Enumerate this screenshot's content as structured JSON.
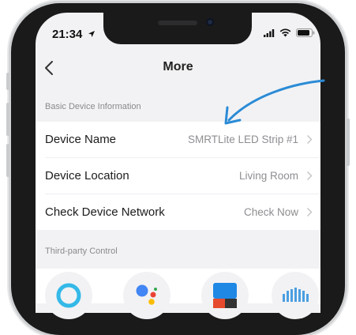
{
  "status": {
    "time": "21:34"
  },
  "nav": {
    "title": "More"
  },
  "sections": [
    {
      "header": "Basic Device Information",
      "rows": [
        {
          "label": "Device Name",
          "value": "SMRTLite LED Strip #1"
        },
        {
          "label": "Device Location",
          "value": "Living Room"
        },
        {
          "label": "Check Device Network",
          "value": "Check Now"
        }
      ]
    },
    {
      "header": "Third-party Control",
      "icons": [
        "alexa-icon",
        "google-assistant-icon",
        "smartthings-icon",
        "ifttt-icon"
      ]
    }
  ],
  "colors": {
    "annotation_arrow": "#2b8bd6",
    "background": "#f2f2f4",
    "value_text": "#8e8e93"
  }
}
